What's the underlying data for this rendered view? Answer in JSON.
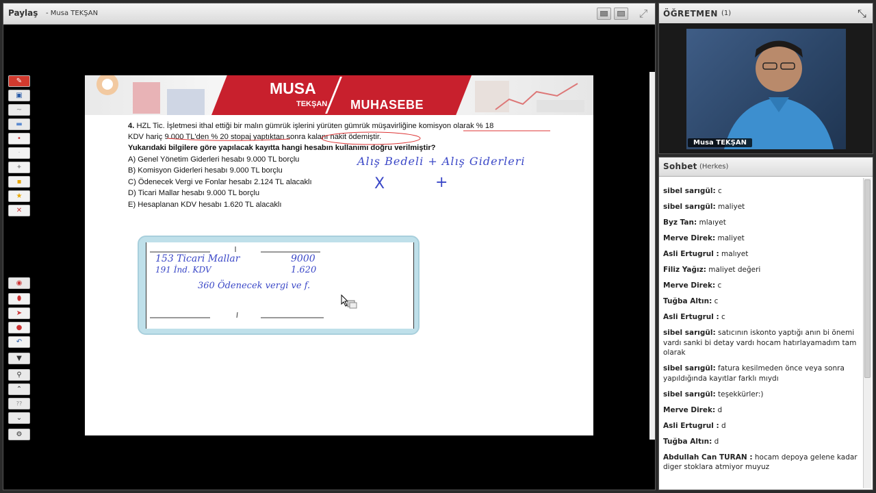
{
  "share": {
    "title": "Paylaş",
    "subtitle": "- Musa TEKŞAN"
  },
  "slide": {
    "brand": {
      "musa": "MUSA",
      "teksan": "TEKŞAN",
      "muhasebe": "MUHASEBE"
    },
    "question": {
      "line1_num": "4.",
      "line1": "HZL Tic. İşletmesi ithal ettiği bir malın gümrük işlerini yürüten gümrük müşavirliğine komisyon olarak % 18",
      "line2": "KDV hariç 9.000 TL'den % 20 stopaj yaptıktan sonra kalanı nakit ödemiştir.",
      "line3": "Yukarıdaki bilgilere göre yapılacak kayıtta hangi hesabın kullanımı doğru verilmiştir?",
      "options": [
        "A) Genel Yönetim Giderleri hesabı 9.000 TL borçlu",
        "B) Komisyon Giderleri hesabı 9.000 TL borçlu",
        "C) Ödenecek Vergi ve Fonlar hesabı 2.124 TL alacaklı",
        "D) Ticari Mallar hesabı 9.000 TL borçlu",
        "E) Hesaplanan KDV hesabı 1.620 TL alacaklı"
      ]
    },
    "handwriting": {
      "top": "Alış Bedeli  + Alış Giderleri",
      "x_mark": "X",
      "plus_mark": "+",
      "row1_acc": "153 Ticari Mallar",
      "row1_val": "9000",
      "row2_acc": "191 İnd. KDV",
      "row2_val": "1.620",
      "row3": "360 Ödenecek vergi ve f."
    }
  },
  "teacher": {
    "title": "ÖĞRETMEN",
    "count": "(1)",
    "name": "Musa TEKŞAN"
  },
  "chat": {
    "title": "Sohbet",
    "scope": "(Herkes)",
    "messages": [
      {
        "user": "sibel sarıgül:",
        "text": "c"
      },
      {
        "user": "sibel sarıgül:",
        "text": "maliyet"
      },
      {
        "user": "Byz Tan:",
        "text": "mlaıyet"
      },
      {
        "user": "Merve Direk:",
        "text": "maliyet"
      },
      {
        "user": "Asli Ertugrul :",
        "text": "malıyet"
      },
      {
        "user": "Filiz Yağız:",
        "text": "maliyet değeri"
      },
      {
        "user": "Merve Direk:",
        "text": "c"
      },
      {
        "user": "Tuğba  Altın:",
        "text": "c"
      },
      {
        "user": "Asli Ertugrul :",
        "text": "c"
      },
      {
        "user": "sibel sarıgül:",
        "text": "satıcının iskonto yaptığı anın bi önemi vardı sanki bi detay vardı hocam hatırlayamadım tam olarak"
      },
      {
        "user": "sibel sarıgül:",
        "text": "fatura kesilmeden önce veya sonra yapıldığında kayıtlar farklı mıydı"
      },
      {
        "user": "sibel sarıgül:",
        "text": "teşekkürler:)"
      },
      {
        "user": "Merve Direk:",
        "text": "d"
      },
      {
        "user": "Asli Ertugrul :",
        "text": "d"
      },
      {
        "user": "Tuğba  Altın:",
        "text": "d"
      },
      {
        "user": "Abdullah Can  TURAN :",
        "text": "hocam depoya gelene kadar diger stoklara atmiyor muyuz"
      }
    ]
  },
  "toolbar": {
    "tools": [
      "pen-tool",
      "save-tool",
      "line-tool",
      "rect-tool",
      "red-dot-tool",
      "white-tool",
      "tool-7",
      "tool-8",
      "star-tool",
      "close-tool"
    ],
    "tools2": [
      "eraser-tool",
      "delete-tool",
      "pointer-tool",
      "marker-tool",
      "undo-tool",
      "dropdown-tool",
      "zoom-tool",
      "up-tool",
      "page-tool",
      "down-tool",
      "settings-tool"
    ],
    "page_label": "??",
    "colors": {
      "accent_red": "#c8202d"
    }
  }
}
